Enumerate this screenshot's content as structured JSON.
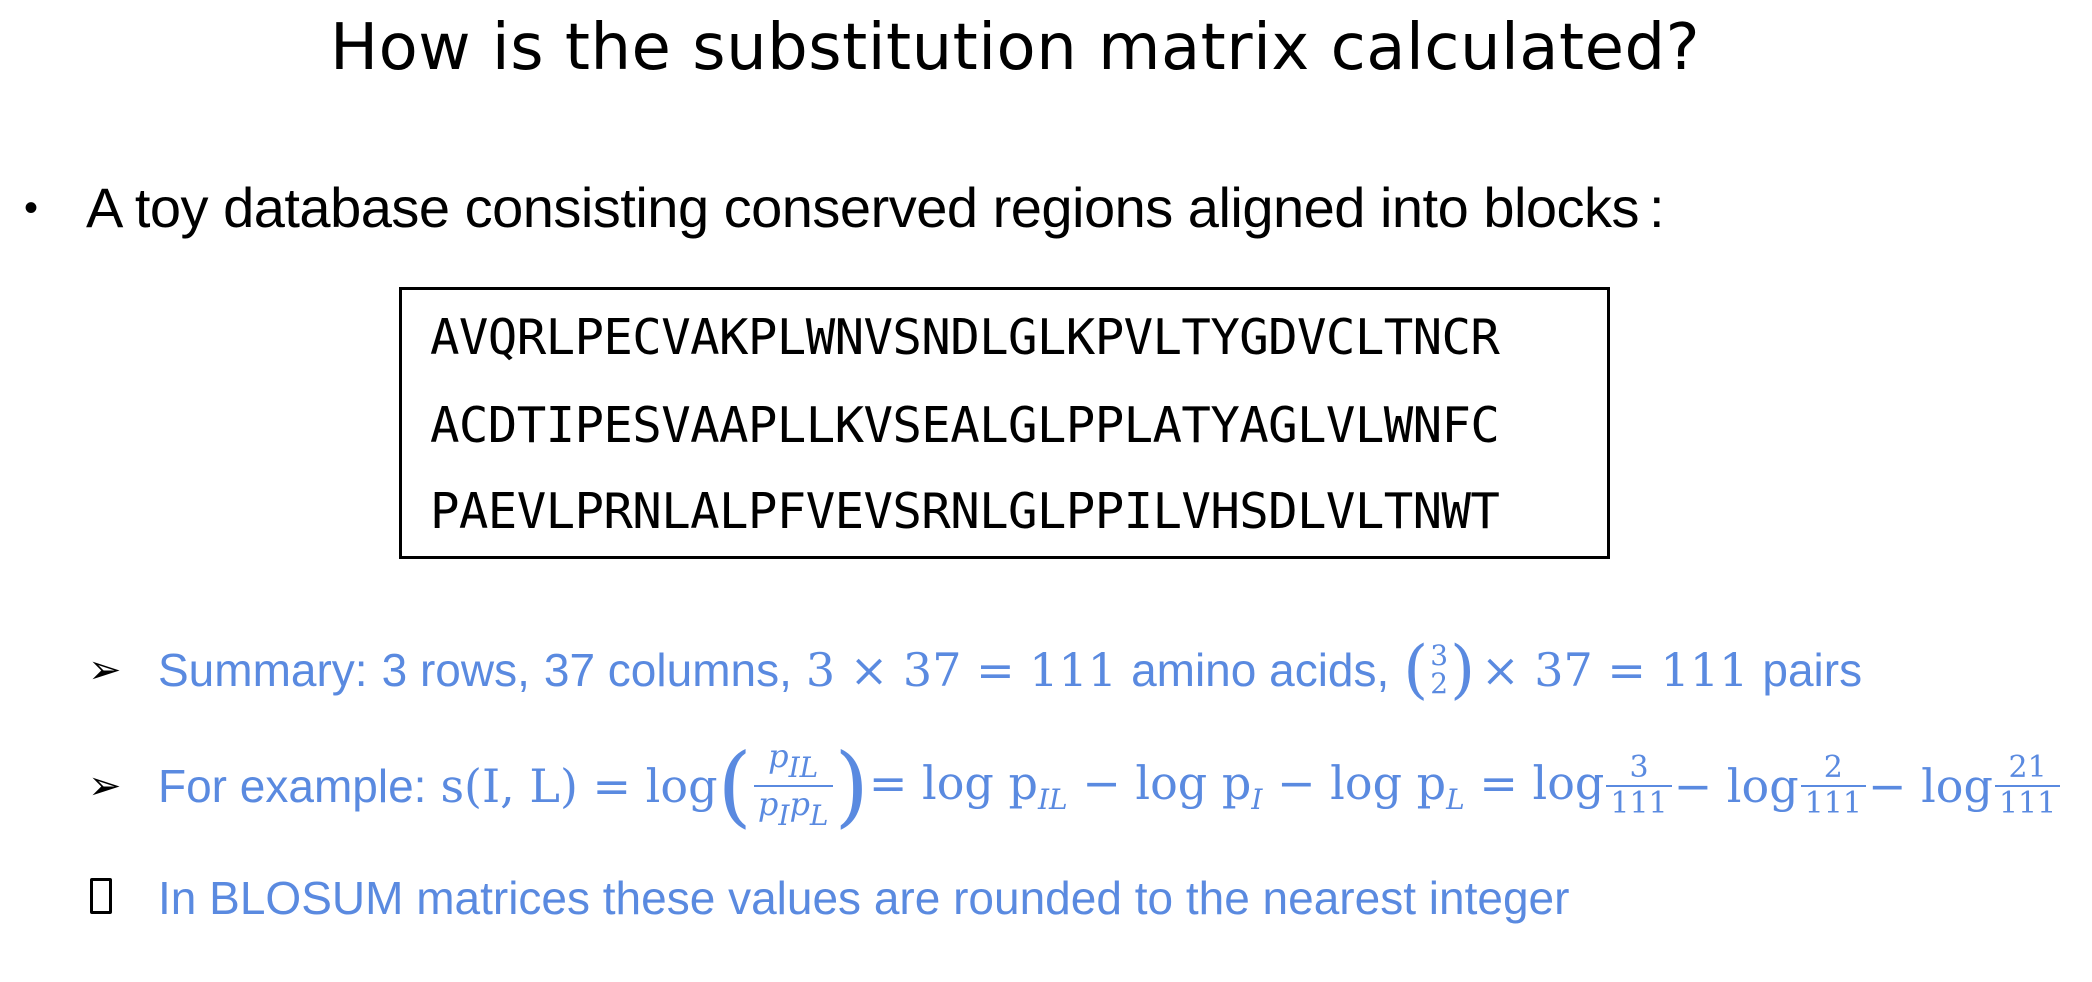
{
  "title": "How is the substitution matrix calculated?",
  "bullet": {
    "symbol": "•",
    "text": "A toy database consisting conserved regions aligned into blocks",
    "colon": ":"
  },
  "sequences": [
    "AVQRLPECVAKPLWNVSNDLGLKPVLTYGDVCLTNCR",
    "ACDTIPESVAAPLLKVSEALGLPPLATYAGLVLWNFC",
    "PAEVLPRNLALPFVEVSRNLGLPPILVHSDLVLTNWT"
  ],
  "summary": {
    "label": "Summary:",
    "rows_text": "3 rows,",
    "cols_text": "37 columns,",
    "product": "3 × 37 = 111",
    "aa_text": "amino acids,",
    "binom_top": "3",
    "binom_bottom": "2",
    "pairs_expr": "× 37 = 111",
    "pairs_text": "pairs"
  },
  "example": {
    "label": "For example:",
    "lhs": "s(I, L) = log",
    "frac_num": "p",
    "frac_num_sub": "IL",
    "frac_den_a": "p",
    "frac_den_a_sub": "I",
    "frac_den_b": "p",
    "frac_den_b_sub": "L",
    "mid1": "= log p",
    "mid1_sub": "IL",
    "mid2": "− log p",
    "mid2_sub": "I",
    "mid3": "− log p",
    "mid3_sub": "L",
    "eq": "= log",
    "f1_num": "3",
    "f1_den": "111",
    "minus_log_1": "− log",
    "f2_num": "2",
    "f2_den": "111",
    "minus_log_2": "− log",
    "f3_num": "21",
    "f3_den": "111"
  },
  "note": {
    "text": "In BLOSUM matrices these values are rounded to the nearest integer"
  },
  "colors": {
    "accent": "#5a8ae0",
    "text": "#000000"
  },
  "icons": {
    "arrow": "arrowhead-bullet-icon",
    "square": "square-bullet-icon"
  }
}
